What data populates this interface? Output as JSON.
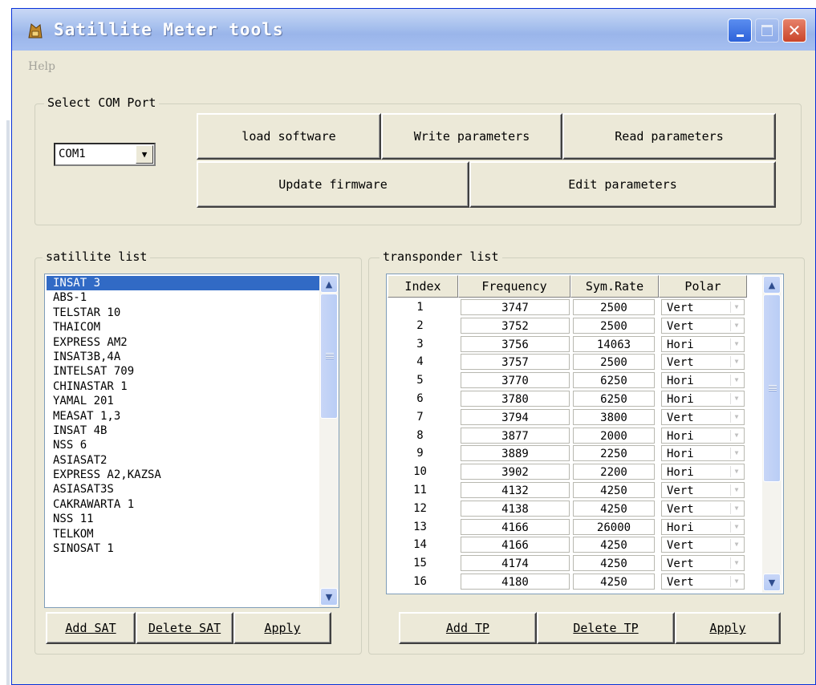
{
  "window": {
    "title": "Satillite Meter tools"
  },
  "menu": {
    "help": "Help"
  },
  "com_port": {
    "label": "Select COM Port",
    "selected": "COM1"
  },
  "buttons": {
    "load_software": "load software",
    "write_parameters": "Write parameters",
    "read_parameters": "Read parameters",
    "update_firmware": "Update firmware",
    "edit_parameters": "Edit parameters"
  },
  "satellite_list": {
    "label": "satillite list",
    "items": [
      "INSAT 3",
      "ABS-1",
      "TELSTAR 10",
      "THAICOM",
      "EXPRESS AM2",
      "INSAT3B,4A",
      "INTELSAT 709",
      "CHINASTAR 1",
      "YAMAL 201",
      "MEASAT 1,3",
      "INSAT 4B",
      "NSS 6",
      "ASIASAT2",
      "EXPRESS A2,KAZSA",
      "ASIASAT3S",
      "CAKRAWARTA 1",
      "NSS 11",
      "TELKOM",
      "SINOSAT 1"
    ],
    "selected_index": 0,
    "add": "Add SAT",
    "delete": "Delete SAT",
    "apply": "Apply"
  },
  "transponder_list": {
    "label": "transponder list",
    "columns": [
      "Index",
      "Frequency",
      "Sym.Rate",
      "Polar"
    ],
    "rows": [
      {
        "index": "1",
        "freq": "3747",
        "sym": "2500",
        "polar": "Vert"
      },
      {
        "index": "2",
        "freq": "3752",
        "sym": "2500",
        "polar": "Vert"
      },
      {
        "index": "3",
        "freq": "3756",
        "sym": "14063",
        "polar": "Hori"
      },
      {
        "index": "4",
        "freq": "3757",
        "sym": "2500",
        "polar": "Vert"
      },
      {
        "index": "5",
        "freq": "3770",
        "sym": "6250",
        "polar": "Hori"
      },
      {
        "index": "6",
        "freq": "3780",
        "sym": "6250",
        "polar": "Hori"
      },
      {
        "index": "7",
        "freq": "3794",
        "sym": "3800",
        "polar": "Vert"
      },
      {
        "index": "8",
        "freq": "3877",
        "sym": "2000",
        "polar": "Hori"
      },
      {
        "index": "9",
        "freq": "3889",
        "sym": "2250",
        "polar": "Hori"
      },
      {
        "index": "10",
        "freq": "3902",
        "sym": "2200",
        "polar": "Hori"
      },
      {
        "index": "11",
        "freq": "4132",
        "sym": "4250",
        "polar": "Vert"
      },
      {
        "index": "12",
        "freq": "4138",
        "sym": "4250",
        "polar": "Vert"
      },
      {
        "index": "13",
        "freq": "4166",
        "sym": "26000",
        "polar": "Hori"
      },
      {
        "index": "14",
        "freq": "4166",
        "sym": "4250",
        "polar": "Vert"
      },
      {
        "index": "15",
        "freq": "4174",
        "sym": "4250",
        "polar": "Vert"
      },
      {
        "index": "16",
        "freq": "4180",
        "sym": "4250",
        "polar": "Vert"
      }
    ],
    "add": "Add TP",
    "delete": "Delete TP",
    "apply": "Apply"
  }
}
